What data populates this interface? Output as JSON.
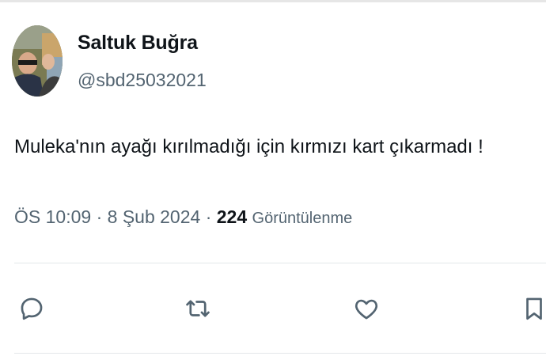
{
  "author": {
    "name": "Saltuk Buğra",
    "handle": "@sbd25032021"
  },
  "tweet": {
    "text": "Muleka'nın ayağı kırılmadığı için kırmızı kart çıkarmadı !"
  },
  "meta": {
    "time": "ÖS 10:09",
    "separator1": " · ",
    "date": "8 Şub 2024",
    "separator2": " · ",
    "views_count": "224",
    "views_label": "Görüntülenme"
  },
  "actions": {
    "icons": [
      "reply-icon",
      "retweet-icon",
      "like-icon",
      "bookmark-icon"
    ]
  },
  "colors": {
    "text_primary": "#0f1419",
    "text_secondary": "#536471",
    "divider": "#e3e7ea"
  }
}
